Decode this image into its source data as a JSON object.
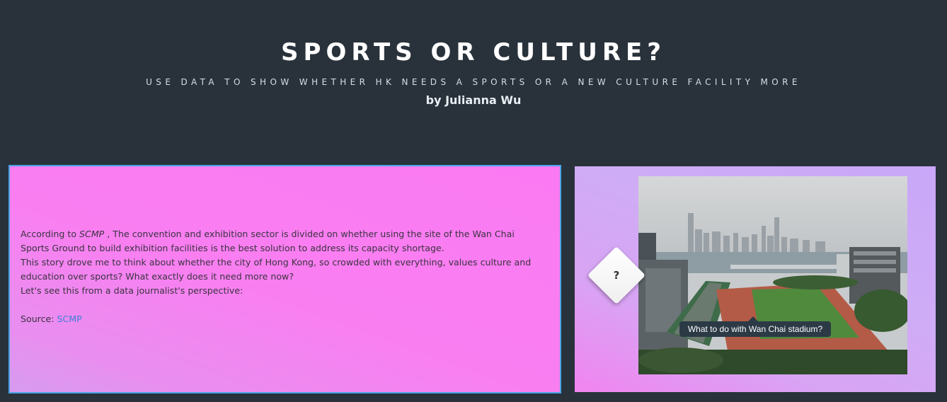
{
  "header": {
    "title": "SPORTS OR CULTURE?",
    "subtitle": "USE DATA TO SHOW WHETHER HK NEEDS A SPORTS OR A NEW CULTURE FACILITY MORE",
    "byline": "by Julianna Wu"
  },
  "intro": {
    "p1_prefix": "According to ",
    "p1_source": "SCMP",
    "p1_rest": " , The convention and exhibition sector is divided on whether using the site of the Wan Chai Sports Ground to build exhibition facilities is the best solution to address its capacity shortage.",
    "p2": "This story drove me to think about whether the city of Hong Kong, so crowded with everything, values culture and education over sports? What exactly does it need more now?",
    "p3": "Let's see this from a data journalist's perspective:",
    "source_label": "Source: ",
    "source_link": "SCMP"
  },
  "media": {
    "marker_label": "?",
    "tooltip": "What to do with Wan Chai stadium?"
  },
  "colors": {
    "background": "#29323b",
    "text_panel_border": "#4aa4e6",
    "link": "#3f7fd6",
    "tooltip_bg": "#2c3a46"
  }
}
